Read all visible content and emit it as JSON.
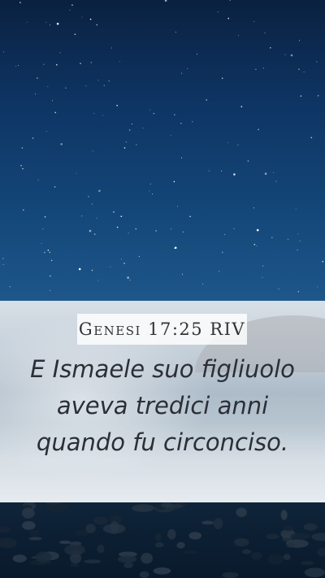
{
  "reference": "Genesi 17:25 RIV",
  "verse": "E Ismaele suo figliuolo aveva tredici anni quando fu circonciso."
}
